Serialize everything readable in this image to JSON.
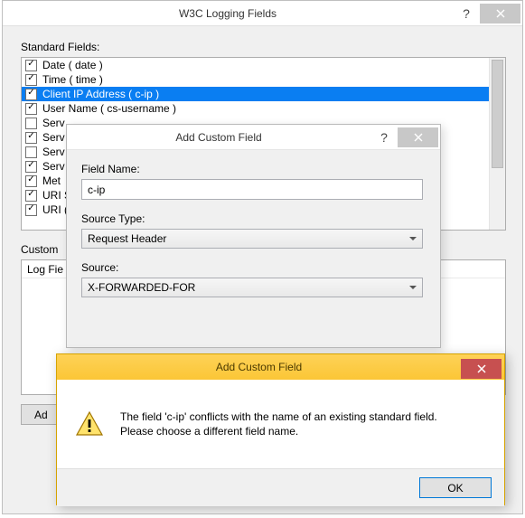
{
  "main": {
    "title": "W3C Logging Fields",
    "standard_label": "Standard Fields:",
    "fields": [
      {
        "label": "Date ( date )",
        "checked": true,
        "selected": false
      },
      {
        "label": "Time ( time )",
        "checked": true,
        "selected": false
      },
      {
        "label": "Client IP Address ( c-ip )",
        "checked": true,
        "selected": true
      },
      {
        "label": "User Name ( cs-username )",
        "checked": true,
        "selected": false
      },
      {
        "label": "Serv",
        "checked": false,
        "selected": false
      },
      {
        "label": "Serv",
        "checked": true,
        "selected": false
      },
      {
        "label": "Serv",
        "checked": false,
        "selected": false
      },
      {
        "label": "Serv",
        "checked": true,
        "selected": false
      },
      {
        "label": "Met",
        "checked": true,
        "selected": false
      },
      {
        "label": "URI S",
        "checked": true,
        "selected": false
      },
      {
        "label": "URI (",
        "checked": true,
        "selected": false
      }
    ],
    "custom_label": "Custom",
    "custom_header": "Log Fie",
    "add_btn": "Ad"
  },
  "add_dialog": {
    "title": "Add Custom Field",
    "field_name_label": "Field Name:",
    "field_name_value": "c-ip",
    "source_type_label": "Source Type:",
    "source_type_value": "Request Header",
    "source_label": "Source:",
    "source_value": "X-FORWARDED-FOR"
  },
  "warn_dialog": {
    "title": "Add Custom Field",
    "line1": "The field 'c-ip' conflicts with the name of an existing standard field.",
    "line2": "Please choose a different field name.",
    "ok": "OK"
  }
}
